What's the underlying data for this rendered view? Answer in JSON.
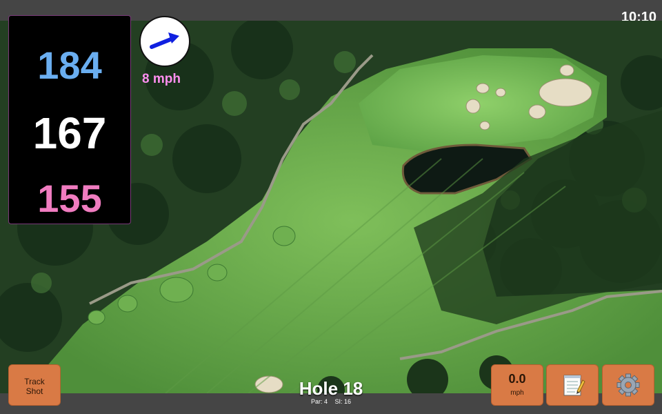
{
  "status": {
    "time": "10:10"
  },
  "distances": {
    "back": "184",
    "middle": "167",
    "front": "155"
  },
  "wind": {
    "speed_label": "8 mph"
  },
  "hole": {
    "title": "Hole 18",
    "par": "Par: 4",
    "stroke_index": "SI: 16"
  },
  "buttons": {
    "track_shot_line1": "Track",
    "track_shot_line2": "Shot",
    "speed_value": "0.0",
    "speed_unit": "mph",
    "notes_icon": "notepad-icon",
    "settings_icon": "gear-icon"
  },
  "colors": {
    "back": "#6aaef0",
    "middle": "#ffffff",
    "front": "#f07cc0",
    "wind_text": "#ff8ff0",
    "button": "#d97a45",
    "wind_arrow": "#1020e0"
  }
}
